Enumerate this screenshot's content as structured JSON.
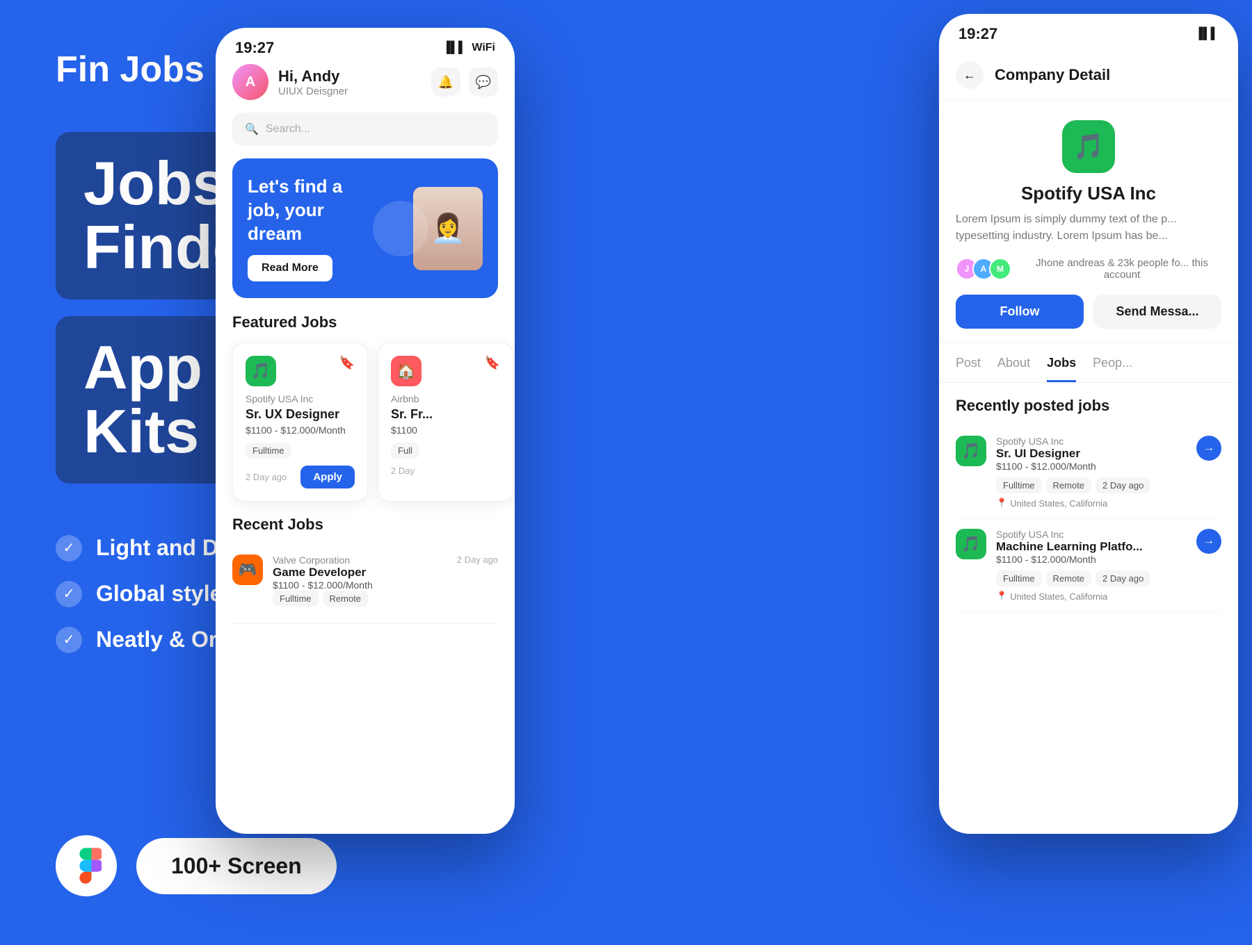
{
  "brand": {
    "title": "Fin Jobs"
  },
  "headlines": {
    "line1": "Jobs Finder",
    "line2": "App UI Kits"
  },
  "features": [
    {
      "id": "feature-1",
      "text": "Light and Dark Theme"
    },
    {
      "id": "feature-2",
      "text": "Global style guide"
    },
    {
      "id": "feature-3",
      "text": "Neatly & Organized Layer"
    }
  ],
  "bottom": {
    "screen_count": "100+ Screen"
  },
  "phone_main": {
    "status_time": "19:27",
    "user_name": "Hi, Andy",
    "user_role": "UIUX Deisgner",
    "search_placeholder": "Search...",
    "hero_title": "Let's find a job, your dream",
    "hero_btn": "Read More",
    "featured_section": "Featured Jobs",
    "recent_section": "Recent Jobs",
    "featured_jobs": [
      {
        "company": "Spotify USA Inc",
        "title": "Sr. UX Designer",
        "salary": "$1100 - $12.000/Month",
        "tag": "Fulltime",
        "time": "2 Day ago",
        "logo_emoji": "🎵"
      },
      {
        "company": "Airbnb",
        "title": "Sr. Fr...",
        "salary": "$1100",
        "tag": "Full",
        "time": "2 Day",
        "logo_emoji": "🏠"
      }
    ],
    "recent_jobs": [
      {
        "company": "Valve Corporation",
        "title": "Game Developer",
        "salary": "$1100 - $12.000/Month",
        "tags": [
          "Fulltime",
          "Remote"
        ],
        "time": "2 Day ago",
        "logo_emoji": "🎮"
      }
    ]
  },
  "phone_detail": {
    "status_time": "19:27",
    "header_title": "Company Detail",
    "company_name": "Spotify USA Inc",
    "company_desc": "Lorem Ipsum is simply dummy text of the p... typesetting industry. Lorem Ipsum has be...",
    "followers_text": "Jhone andreas & 23k people fo... this account",
    "follow_btn": "Follow",
    "message_btn": "Send Messa...",
    "tabs": [
      "Post",
      "About",
      "Jobs",
      "Peop..."
    ],
    "active_tab": "Jobs",
    "recently_title": "Recently posted jobs",
    "recent_jobs": [
      {
        "company": "Spotify USA Inc",
        "title": "Sr. UI Designer",
        "salary": "$1100 - $12.000/Month",
        "tags": [
          "Fulltime",
          "Remote",
          "2 Day ago"
        ],
        "location": "United States, California",
        "logo_emoji": "🎵"
      },
      {
        "company": "Spotify USA Inc",
        "title": "Machine Learning Platfo...",
        "salary": "$1100 - $12.000/Month",
        "tags": [
          "Fulltime",
          "Remote",
          "2 Day ago"
        ],
        "location": "United States, California",
        "logo_emoji": "🎵"
      }
    ]
  }
}
